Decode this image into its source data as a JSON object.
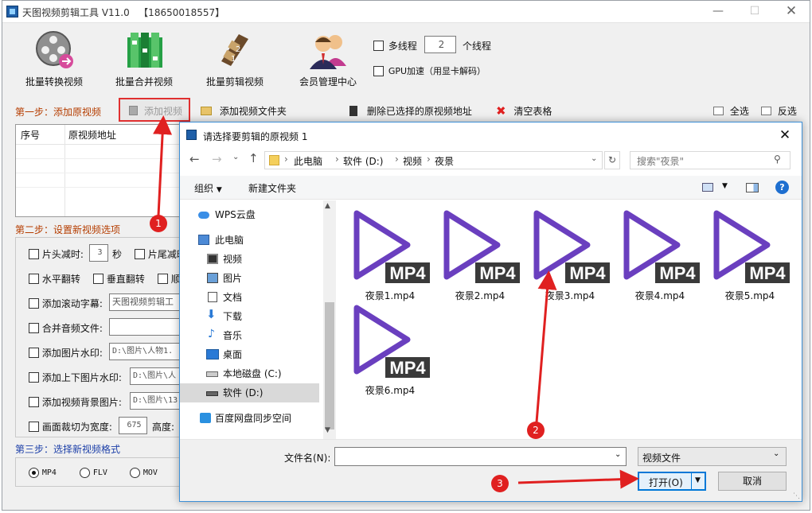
{
  "window": {
    "title": "天图视频剪辑工具 V11.0   【18650018557】"
  },
  "toolbar": {
    "tools": [
      "批量转换视频",
      "批量合并视频",
      "批量剪辑视频",
      "会员管理中心"
    ],
    "multithread_label": "多线程",
    "thread_count": "2",
    "thread_unit": "个线程",
    "gpu_label": "GPU加速（用显卡解码）"
  },
  "step1": {
    "title": "第一步：添加原视频",
    "add_video": "添加视频",
    "add_folder": "添加视频文件夹",
    "delete_selected": "删除已选择的原视频地址",
    "clear_table": "清空表格",
    "select_all": "全选",
    "invert": "反选",
    "columns": [
      "序号",
      "原视频地址"
    ]
  },
  "step2": {
    "title": "第二步：设置新视频选项",
    "head_cut": "片头减时:",
    "head_cut_value": "3",
    "seconds": "秒",
    "tail_cut": "片尾减时",
    "hflip": "水平翻转",
    "vflip": "垂直翻转",
    "clockwise": "顺",
    "scroll_caption": "添加滚动字幕:",
    "scroll_caption_value": "天图视频剪辑工",
    "merge_audio": "合并音频文件:",
    "merge_audio_value": "",
    "img_watermark": "添加图片水印:",
    "img_watermark_value": "D:\\图片\\人物1.",
    "tb_watermark": "添加上下图片水印:",
    "tb_watermark_value": "D:\\图片\\人",
    "bg_image": "添加视频背景图片:",
    "bg_image_value": "D:\\图片\\13",
    "crop_label": "画面裁切为宽度:",
    "crop_width": "675",
    "height_label": "高度:"
  },
  "step3": {
    "title": "第三步：选择新视频格式",
    "formats": [
      "MP4",
      "FLV",
      "MOV"
    ],
    "selected": "MP4"
  },
  "dialog": {
    "title": "请选择要剪辑的原视频 1",
    "breadcrumb": [
      "此电脑",
      "软件 (D:)",
      "视频",
      "夜景"
    ],
    "search_placeholder": "搜索\"夜景\"",
    "organize": "组织",
    "new_folder": "新建文件夹",
    "nav": [
      "WPS云盘",
      "此电脑",
      "视频",
      "图片",
      "文档",
      "下载",
      "音乐",
      "桌面",
      "本地磁盘 (C:)",
      "软件 (D:)",
      "百度网盘同步空间"
    ],
    "files": [
      "夜景1.mp4",
      "夜景2.mp4",
      "夜景3.mp4",
      "夜景4.mp4",
      "夜景5.mp4",
      "夜景6.mp4"
    ],
    "mp4_text": "MP4",
    "filename_label": "文件名(N):",
    "filename_value": "",
    "filetype": "视频文件",
    "open_button": "打开(O)",
    "cancel_button": "取消"
  },
  "annotations": {
    "markers": [
      "1",
      "2",
      "3"
    ]
  },
  "colors": {
    "accent": "#e02020",
    "play_icon": "#6a3fbf",
    "dialog_border": "#3c8fd6"
  }
}
